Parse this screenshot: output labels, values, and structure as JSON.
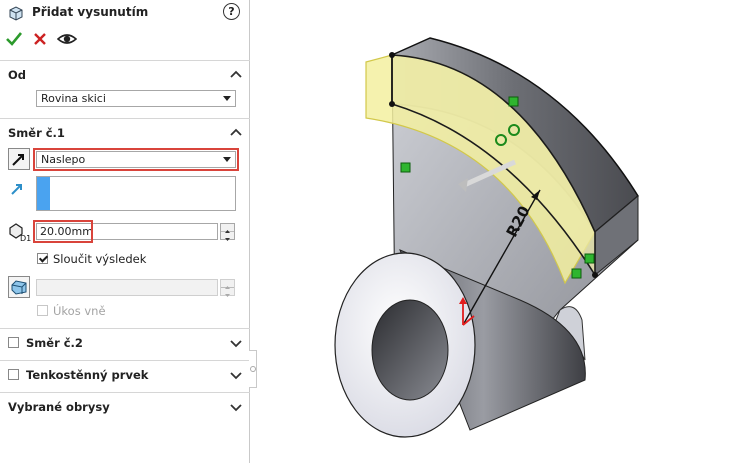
{
  "panel": {
    "title": "Přidat vysunutím",
    "help_label": "?",
    "actions": {
      "ok_icon": "check-icon",
      "cancel_icon": "x-icon",
      "preview_icon": "eye-icon"
    }
  },
  "from_section": {
    "title": "Od",
    "start_condition": "Rovina skici"
  },
  "direction1": {
    "title": "Směr č.1",
    "end_condition": "Naslepo",
    "depth": "20.00mm",
    "merge_result_label": "Sloučit výsledek",
    "merge_result_checked": true,
    "draft_outward_label": "Úkos vně"
  },
  "direction2": {
    "title": "Směr č.2"
  },
  "thin_feature": {
    "title": "Tenkostěnný prvek"
  },
  "selected_contours": {
    "title": "Vybrané obrysy"
  },
  "model": {
    "dimension_label": "R20"
  },
  "colors": {
    "highlight_red": "#d9443b",
    "accent_blue": "#4aa3f0",
    "preview_yellow": "#f3f0a0"
  }
}
